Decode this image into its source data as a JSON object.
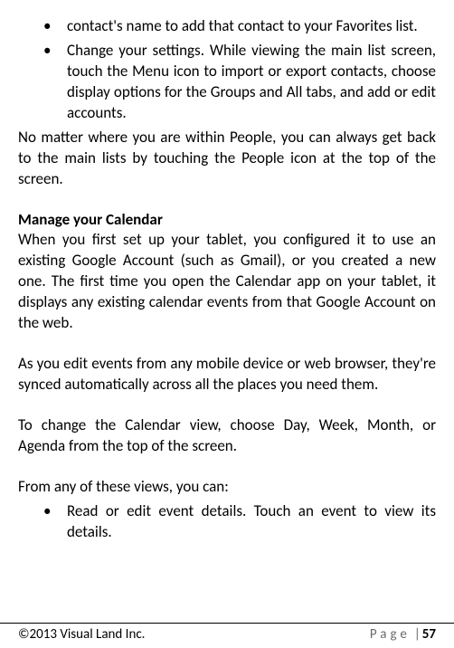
{
  "bullets_top": [
    "contact's name to add that contact to your Favorites list.",
    "Change your settings. While viewing the main list screen, touch the   Menu icon to import or export contacts, choose display options for the Groups and All tabs, and add or edit accounts."
  ],
  "para_nomatter": "No matter where you are within People, you can always get back to the main lists by touching the   People icon at the top of the screen.",
  "heading_calendar": "Manage your Calendar",
  "para_cal_intro": "When you first set up your tablet, you configured it to use an existing Google Account (such as Gmail), or you created a new one. The first time you open the Calendar app on your tablet, it displays any existing calendar events from that Google Account on the web.",
  "para_cal_sync": "As you edit events from any mobile device or web browser, they're synced automatically across all the places you need them.",
  "para_cal_view": "To change the Calendar view, choose Day, Week, Month, or Agenda from the top of the screen.",
  "para_cal_any": "From any of these views, you can:",
  "bullets_bottom": [
    "Read or edit event details. Touch an event to view its details."
  ],
  "footer": {
    "copyright": "©2013 Visual Land Inc.",
    "page_label": "Page",
    "sep": "|",
    "page_num": "57"
  }
}
